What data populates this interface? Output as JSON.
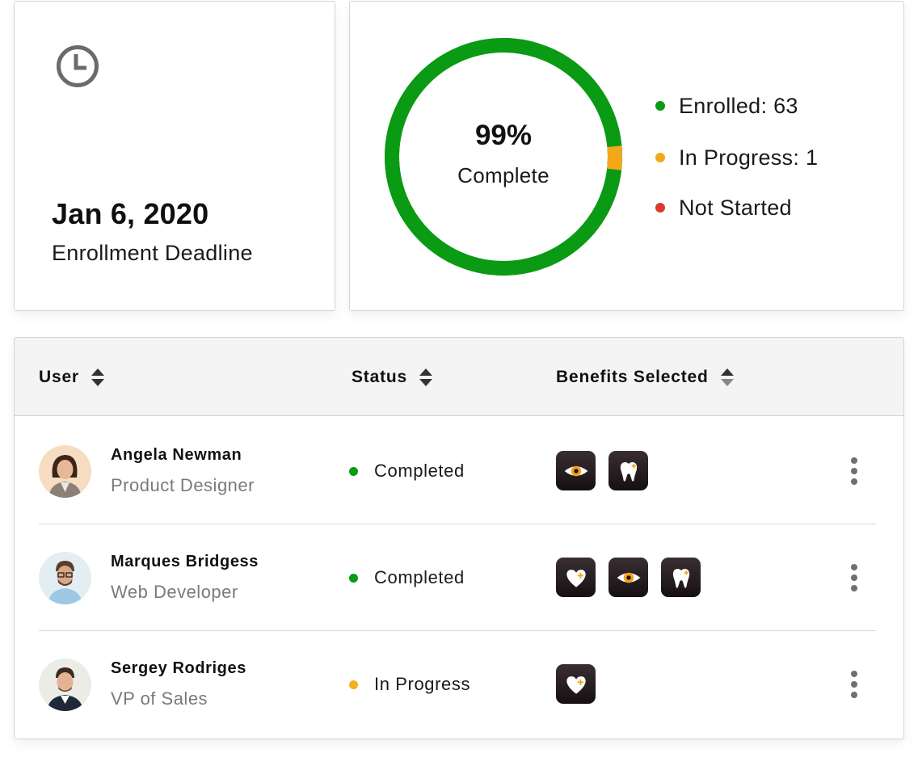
{
  "deadline": {
    "date": "Jan 6, 2020",
    "label": "Enrollment Deadline",
    "icon": "clock-icon"
  },
  "progress": {
    "percent_text": "99%",
    "label": "Complete",
    "completion_fraction": 0.985,
    "legend": [
      {
        "label": "Enrolled: 63",
        "color": "#0a9a13"
      },
      {
        "label": "In Progress: 1",
        "color": "#f3a81c"
      },
      {
        "label": "Not Started",
        "color": "#d93a2b"
      }
    ]
  },
  "table": {
    "columns": [
      "User",
      "Status",
      "Benefits Selected"
    ],
    "rows": [
      {
        "name": "Angela Newman",
        "role": "Product Designer",
        "status": "Completed",
        "status_color": "#0a9a13",
        "benefits": [
          "vision-icon",
          "dental-icon"
        ]
      },
      {
        "name": "Marques Bridgess",
        "role": "Web Developer",
        "status": "Completed",
        "status_color": "#0a9a13",
        "benefits": [
          "health-icon",
          "vision-icon",
          "dental-icon"
        ]
      },
      {
        "name": "Sergey Rodriges",
        "role": "VP of Sales",
        "status": "In Progress",
        "status_color": "#f3b01c",
        "benefits": [
          "health-icon"
        ]
      }
    ]
  },
  "colors": {
    "accent_green": "#0a9a13",
    "accent_orange": "#f3a81c",
    "accent_red": "#d93a2b",
    "benefit_tile": "#1c1518"
  }
}
